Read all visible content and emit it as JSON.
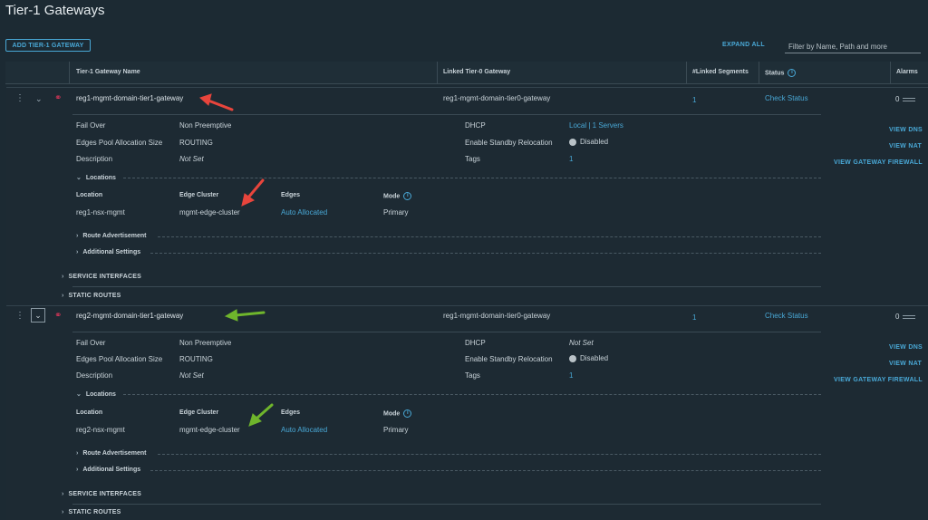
{
  "page": {
    "title": "Tier-1 Gateways"
  },
  "toolbar": {
    "add_label": "ADD TIER-1 GATEWAY",
    "expand_all_label": "EXPAND ALL",
    "filter_placeholder": "Filter by Name, Path and more"
  },
  "table": {
    "columns": [
      "Tier-1 Gateway Name",
      "Linked Tier-0 Gateway",
      "#Linked Segments",
      "Status",
      "Alarms"
    ]
  },
  "gateways": [
    {
      "name": "reg1-mgmt-domain-tier1-gateway",
      "linked_tier0": "reg1-mgmt-domain-tier0-gateway",
      "linked_segments": "1",
      "status": "Check Status",
      "alarms": "0",
      "fail_over_label": "Fail Over",
      "fail_over": "Non Preemptive",
      "edges_pool_label": "Edges Pool Allocation Size",
      "edges_pool": "ROUTING",
      "description_label": "Description",
      "description": "Not Set",
      "dhcp_label": "DHCP",
      "dhcp": "Local | 1 Servers",
      "standby_label": "Enable Standby Relocation",
      "standby": "Disabled",
      "tags_label": "Tags",
      "tags": "1",
      "locations_label": "Locations",
      "loc_headers": {
        "location": "Location",
        "edge_cluster": "Edge Cluster",
        "edges": "Edges",
        "mode": "Mode"
      },
      "location": {
        "location": "reg1-nsx-mgmt",
        "edge_cluster": "mgmt-edge-cluster",
        "edges": "Auto Allocated",
        "mode": "Primary"
      },
      "route_adv_label": "Route Advertisement",
      "additional_label": "Additional Settings",
      "service_interfaces_label": "SERVICE INTERFACES",
      "static_routes_label": "STATIC ROUTES",
      "view_dns": "VIEW DNS",
      "view_nat": "VIEW NAT",
      "view_firewall": "VIEW GATEWAY FIREWALL"
    },
    {
      "name": "reg2-mgmt-domain-tier1-gateway",
      "linked_tier0": "reg1-mgmt-domain-tier0-gateway",
      "linked_segments": "1",
      "status": "Check Status",
      "alarms": "0",
      "fail_over_label": "Fail Over",
      "fail_over": "Non Preemptive",
      "edges_pool_label": "Edges Pool Allocation Size",
      "edges_pool": "ROUTING",
      "description_label": "Description",
      "description": "Not Set",
      "dhcp_label": "DHCP",
      "dhcp": "Not Set",
      "standby_label": "Enable Standby Relocation",
      "standby": "Disabled",
      "tags_label": "Tags",
      "tags": "1",
      "locations_label": "Locations",
      "loc_headers": {
        "location": "Location",
        "edge_cluster": "Edge Cluster",
        "edges": "Edges",
        "mode": "Mode"
      },
      "location": {
        "location": "reg2-nsx-mgmt",
        "edge_cluster": "mgmt-edge-cluster",
        "edges": "Auto Allocated",
        "mode": "Primary"
      },
      "route_adv_label": "Route Advertisement",
      "additional_label": "Additional Settings",
      "service_interfaces_label": "SERVICE INTERFACES",
      "static_routes_label": "STATIC ROUTES",
      "view_dns": "VIEW DNS",
      "view_nat": "VIEW NAT",
      "view_firewall": "VIEW GATEWAY FIREWALL"
    }
  ],
  "colors": {
    "accent": "#49a8d6",
    "gateway_icon": "#e0365a",
    "annotation_red": "#e8453c",
    "annotation_green": "#6fb52c"
  },
  "icons": {
    "gateway": "globe-icon",
    "menu": "kebab-icon",
    "expand": "chevron-down-icon",
    "info": "info-icon"
  }
}
